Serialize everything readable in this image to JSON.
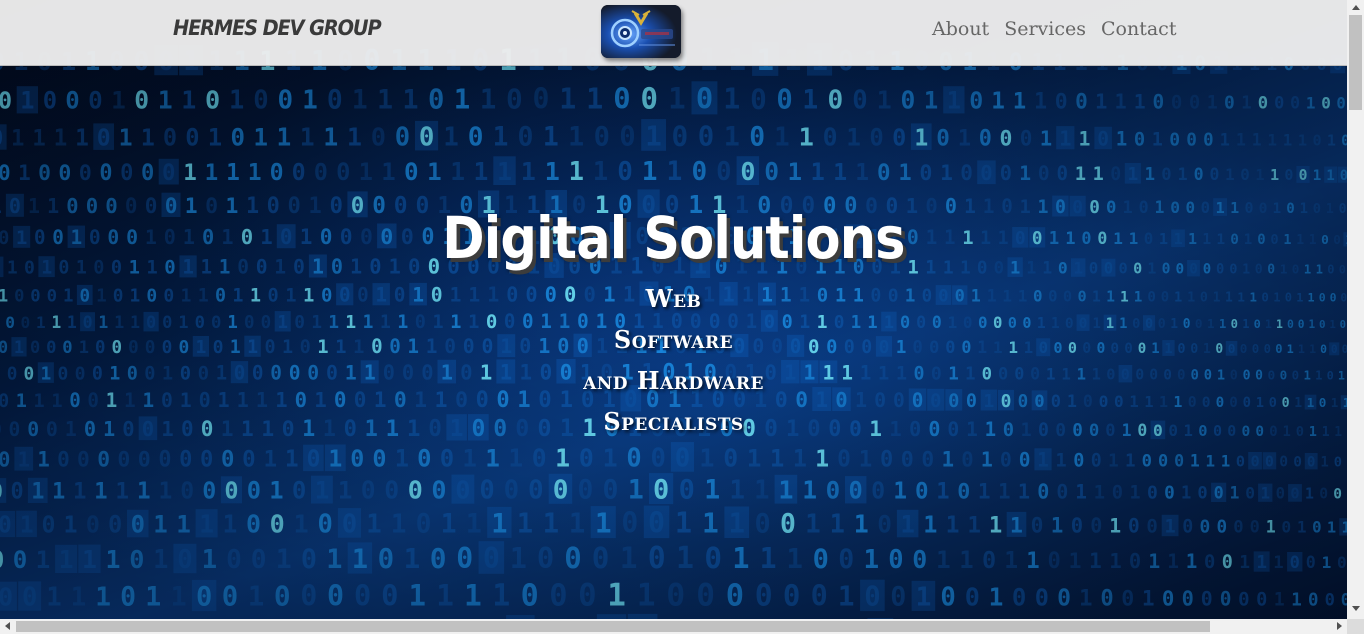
{
  "nav": {
    "brand": "HERMES DEV GROUP",
    "links": [
      "About",
      "Services",
      "Contact"
    ]
  },
  "hero": {
    "headline": "Digital Solutions",
    "lines": [
      "Web",
      "Software",
      "and Hardware",
      "Specialists"
    ]
  },
  "icons": {
    "logo": "hermes-winged-gear-logo",
    "scroll_up": "triangle-up",
    "scroll_down": "triangle-down",
    "scroll_left": "triangle-left",
    "scroll_right": "triangle-right"
  },
  "colors": {
    "navbar_bg": "#eeeeee",
    "brand_text": "#3a3a3a",
    "nav_link": "#666666",
    "hero_text": "#ffffff",
    "binary_glow": "#18b4ff"
  }
}
